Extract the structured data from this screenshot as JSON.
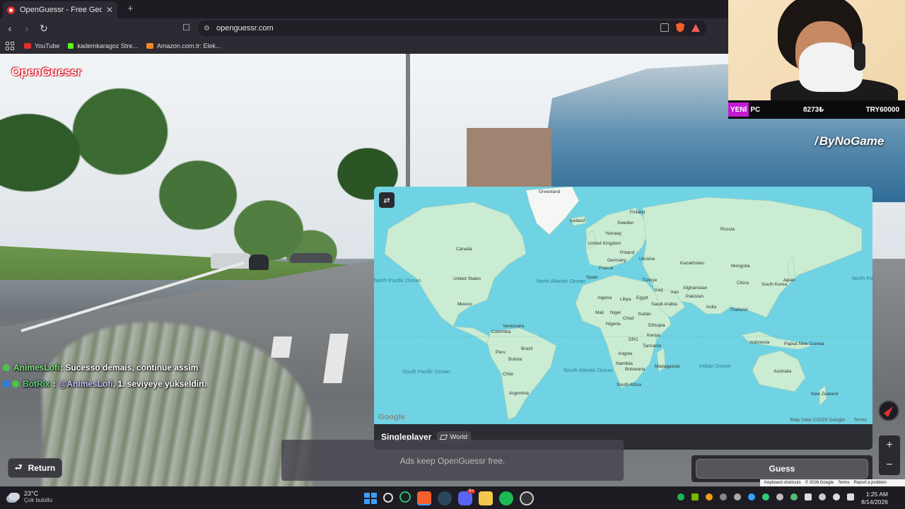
{
  "browser": {
    "tab_title": "OpenGuessr - Free GeoGuess",
    "url": "openguessr.com",
    "bookmarks": [
      {
        "label": "YouTube",
        "color": "#e03131"
      },
      {
        "label": "kademkaragoz Stre...",
        "color": "#53fc18"
      },
      {
        "label": "Amazon.com.tr: Elek...",
        "color": "#f08a24"
      }
    ]
  },
  "game": {
    "logo": "OpenGuessr",
    "mode": "Singleplayer",
    "map_name": "World",
    "ads_text": "Ads keep OpenGuessr free.",
    "return_label": "Return",
    "guess_label": "Guess",
    "map_attribution": "Map Data ©2026 Google",
    "terms": "Terms",
    "google_logo": "Google",
    "footer_links": [
      "Keyboard shortcuts",
      "© 2026 Google",
      "Terms",
      "Report a problem"
    ]
  },
  "map_labels": {
    "countries": [
      "Greenland",
      "Iceland",
      "Finland",
      "Sweden",
      "Norway",
      "Russia",
      "United Kingdom",
      "Poland",
      "Germany",
      "Ukraine",
      "Kazakhstan",
      "Mongolia",
      "France",
      "Spain",
      "Türkiye",
      "Iraq",
      "Iran",
      "Afghanistan",
      "Pakistan",
      "China",
      "South Korea",
      "Japan",
      "India",
      "Thailand",
      "Canada",
      "United States",
      "Mexico",
      "Algeria",
      "Libya",
      "Egypt",
      "Saudi Arabia",
      "Mali",
      "Niger",
      "Chad",
      "Sudan",
      "Nigeria",
      "Ethiopia",
      "Kenya",
      "DRC",
      "Tanzania",
      "Angola",
      "Namibia",
      "Botswana",
      "Madagascar",
      "South Africa",
      "Venezuela",
      "Colombia",
      "Peru",
      "Brazil",
      "Bolivia",
      "Chile",
      "Argentina",
      "Indonesia",
      "Papua New Guinea",
      "Australia",
      "New Zealand"
    ],
    "oceans": [
      "North Atlantic Ocean",
      "North Pacific Ocean",
      "North Pacific Ocean",
      "South Pacific Ocean",
      "South Atlantic Ocean",
      "Indian Ocean"
    ]
  },
  "chat": [
    {
      "user": "AnimesLofi",
      "sep": ":",
      "message": "Sucesso demais, continue assim"
    },
    {
      "user": "BotRix",
      "sep": ":",
      "mention": "@AnimesLofi",
      "message": ", 1. seviyeye yükseldin."
    }
  ],
  "stream": {
    "donation_label_a": "YENİ",
    "donation_label_b": "PC",
    "donation_amount": "8273₺",
    "donation_goal": "TRY60000",
    "brand": "ByNoGame"
  },
  "taskbar": {
    "temperature": "23°C",
    "weather": "Çok bulutlu",
    "time": "1:25 AM",
    "date": "8/14/2026",
    "discord_badge": "9+"
  },
  "colors": {
    "ocean": "#6fd3e3",
    "land": "#c9ecd3",
    "brand_red": "#d9232e"
  },
  "icons": [
    "back-icon",
    "forward-icon",
    "reload-icon",
    "bookmark-icon",
    "lock-icon",
    "brave-shield-icon",
    "translate-icon",
    "apps-grid-icon",
    "layers-icon",
    "map-toggle-icon",
    "return-arrow-icon",
    "compass-icon",
    "zoom-in-icon",
    "zoom-out-icon",
    "windows-icon",
    "search-icon",
    "steam-icon",
    "discord-icon",
    "folder-icon",
    "spotify-icon"
  ]
}
